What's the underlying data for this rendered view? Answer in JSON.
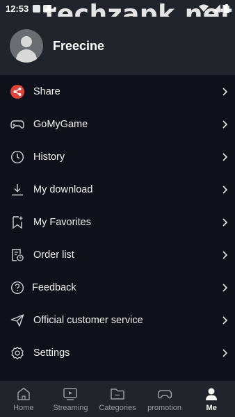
{
  "status_bar": {
    "time": "12:53"
  },
  "watermark": "techzapk.net",
  "profile": {
    "username": "Freecine"
  },
  "menu": [
    {
      "label": "Share",
      "icon": "share-icon"
    },
    {
      "label": "GoMyGame",
      "icon": "gamepad-icon"
    },
    {
      "label": "History",
      "icon": "clock-icon"
    },
    {
      "label": "My download",
      "icon": "download-icon"
    },
    {
      "label": "My Favorites",
      "icon": "bookmark-icon"
    },
    {
      "label": "Order list",
      "icon": "order-list-icon"
    },
    {
      "label": "Feedback",
      "icon": "question-icon"
    },
    {
      "label": "Official customer service",
      "icon": "send-icon"
    },
    {
      "label": "Settings",
      "icon": "gear-icon"
    }
  ],
  "tabs": [
    {
      "label": "Home",
      "icon": "home-icon",
      "active": false
    },
    {
      "label": "Streaming",
      "icon": "play-screen-icon",
      "active": false
    },
    {
      "label": "Categories",
      "icon": "folder-icon",
      "active": false
    },
    {
      "label": "promotion",
      "icon": "gamepad-icon",
      "active": false
    },
    {
      "label": "Me",
      "icon": "person-icon",
      "active": true
    }
  ],
  "colors": {
    "share_accent": "#e0433a",
    "menu_bg": "#0e1119",
    "header_bg": "#22242b"
  }
}
